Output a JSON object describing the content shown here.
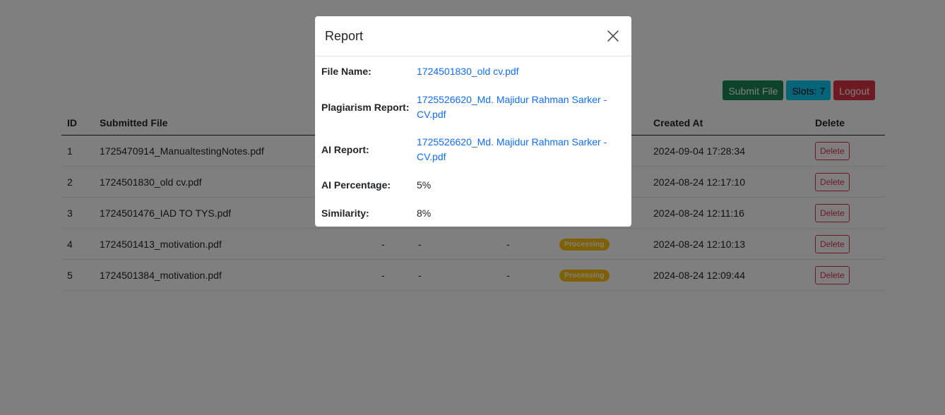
{
  "toolbar": {
    "submit_label": "Submit File",
    "slots_label": "Slots: 7",
    "logout_label": "Logout"
  },
  "table": {
    "headers": {
      "id": "ID",
      "file": "Submitted File",
      "created": "Created At",
      "delete": "Delete"
    },
    "rows": [
      {
        "id": "1",
        "file": "1725470914_ManualtestingNotes.pdf",
        "ai": "",
        "sim": "",
        "pla": "",
        "status": "",
        "created": "2024-09-04 17:28:34",
        "delete": "Delete"
      },
      {
        "id": "2",
        "file": "1724501830_old cv.pdf",
        "ai": "",
        "sim": "",
        "pla": "",
        "status": "",
        "created": "2024-08-24 12:17:10",
        "delete": "Delete"
      },
      {
        "id": "3",
        "file": "1724501476_IAD TO TYS.pdf",
        "ai": "",
        "sim": "",
        "pla": "",
        "status": "",
        "created": "2024-08-24 12:11:16",
        "delete": "Delete"
      },
      {
        "id": "4",
        "file": "1724501413_motivation.pdf",
        "ai": "-",
        "sim": "-",
        "pla": "-",
        "status": "Processing",
        "created": "2024-08-24 12:10:13",
        "delete": "Delete"
      },
      {
        "id": "5",
        "file": "1724501384_motivation.pdf",
        "ai": "-",
        "sim": "-",
        "pla": "-",
        "status": "Processing",
        "created": "2024-08-24 12:09:44",
        "delete": "Delete"
      }
    ]
  },
  "modal": {
    "title": "Report",
    "close_icon": "close-icon",
    "fields": {
      "file_name_label": "File Name:",
      "file_name_value": "1724501830_old cv.pdf",
      "plagiarism_label": "Plagiarism Report:",
      "plagiarism_value": "1725526620_Md. Majidur Rahman Sarker - CV.pdf",
      "ai_report_label": "AI Report:",
      "ai_report_value": "1725526620_Md. Majidur Rahman Sarker - CV.pdf",
      "ai_percentage_label": "AI Percentage:",
      "ai_percentage_value": "5%",
      "similarity_label": "Similarity:",
      "similarity_value": "8%"
    }
  },
  "colors": {
    "success": "#198754",
    "info": "#0dcaf0",
    "danger": "#dc3545",
    "warning": "#ffc107",
    "link": "#0d6efd"
  }
}
